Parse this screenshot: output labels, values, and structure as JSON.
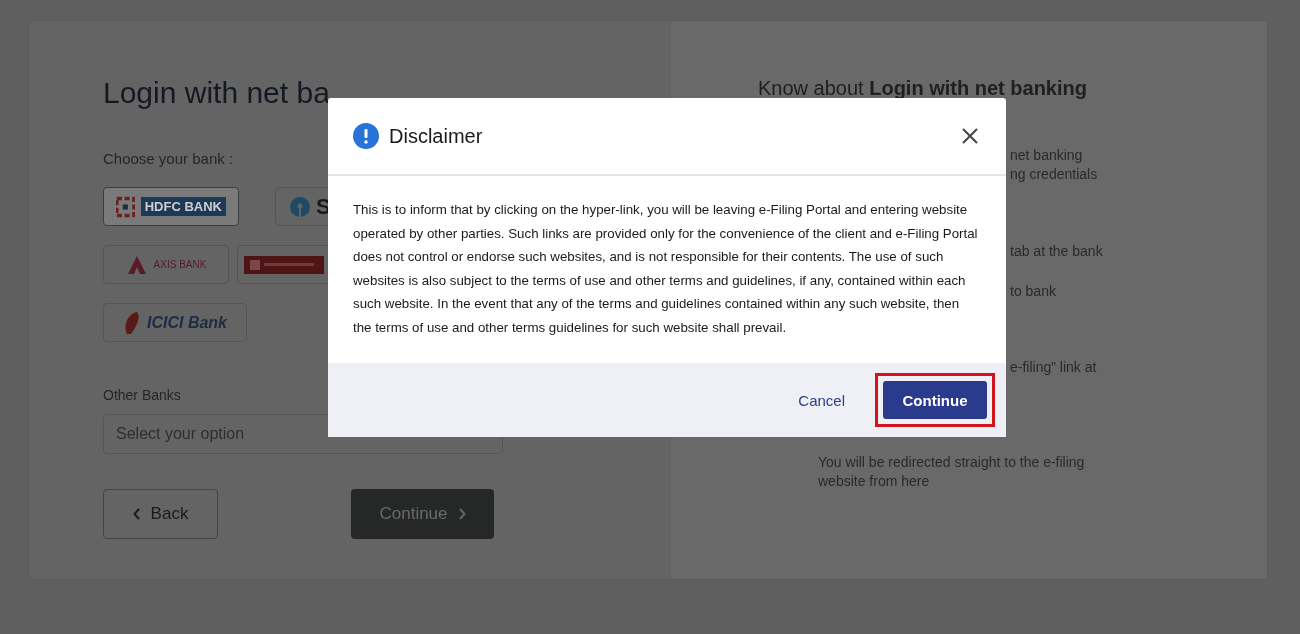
{
  "login": {
    "title": "Login with net ba",
    "choose_label": "Choose your bank :",
    "banks": [
      {
        "kind": "hdfc",
        "label": "HDFC BANK",
        "selected": true
      },
      {
        "kind": "sbi",
        "label": "S",
        "selected": false
      },
      {
        "kind": "axis",
        "label": "AXIS BANK",
        "selected": false
      },
      {
        "kind": "pnb",
        "selected": false
      },
      {
        "kind": "icici",
        "label": "ICICI Bank",
        "selected": false
      }
    ],
    "other_label": "Other Banks",
    "select": {
      "placeholder": "Select your option"
    },
    "back": "Back",
    "continue": {
      "label": "Continue",
      "disabled": true
    }
  },
  "info": {
    "title": "Know about **Login with net banking**",
    "fragments": [
      "net banking",
      "ng credentials",
      "tab at the bank",
      "to bank",
      "e-filing” link at"
    ],
    "last_item": "You will be redirected straight to the e-filing website from here"
  },
  "dialog": {
    "title": "Disclaimer",
    "body": "This is to inform that by clicking on the hyper-link, you will be leaving e-Filing Portal and entering website operated by other parties. Such links are provided only for the convenience of the client and e-Filing Portal does not control or endorse such websites, and is not responsible for their contents. The use of such websites is also subject to the terms of use and other terms and guidelines, if any, contained within each such website. In the event that any of the terms and guidelines contained within any such website, then the terms of use and other terms guidelines for such website shall prevail.",
    "cancel": "Cancel",
    "continue": {
      "label": "Continue",
      "highlighted": true
    }
  }
}
